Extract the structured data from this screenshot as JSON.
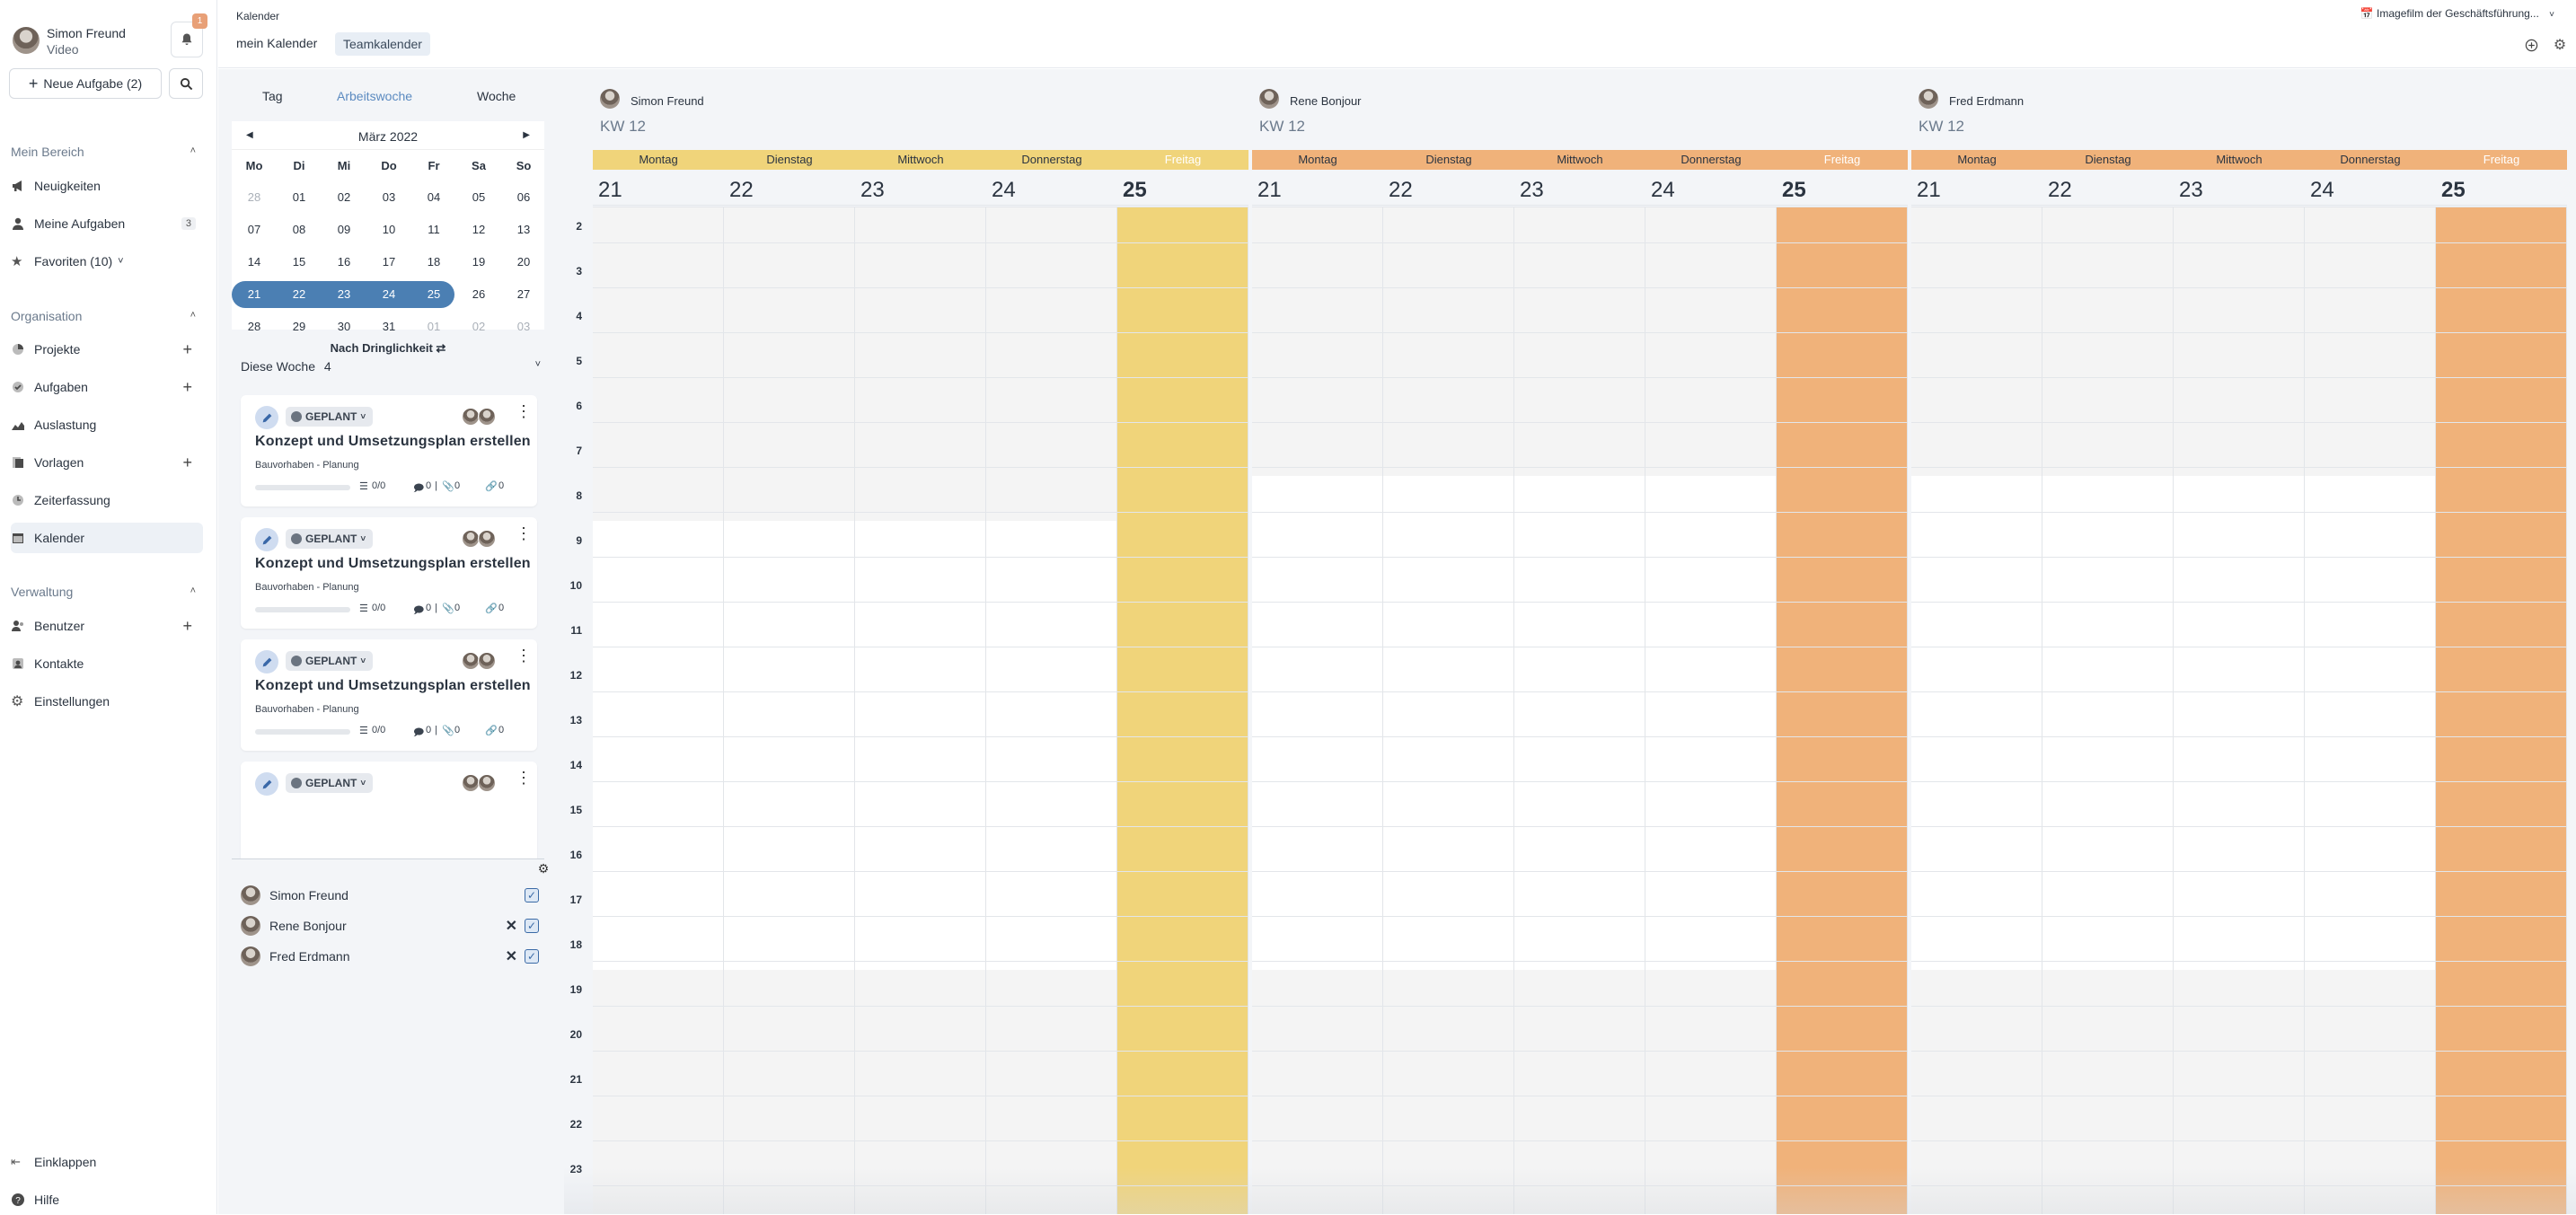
{
  "user": {
    "name": "Simon Freund",
    "role": "Video",
    "notification_count": "1"
  },
  "sidebar": {
    "new_task_label": "Neue Aufgabe (2)",
    "sections": {
      "mein_bereich": "Mein Bereich",
      "organisation": "Organisation",
      "verwaltung": "Verwaltung"
    },
    "items": {
      "neuigkeiten": "Neuigkeiten",
      "meine_aufgaben": "Meine Aufgaben",
      "meine_aufgaben_count": "3",
      "favoriten": "Favoriten (10)",
      "projekte": "Projekte",
      "aufgaben": "Aufgaben",
      "auslastung": "Auslastung",
      "vorlagen": "Vorlagen",
      "zeiterfassung": "Zeiterfassung",
      "kalender": "Kalender",
      "benutzer": "Benutzer",
      "kontakte": "Kontakte",
      "einstellungen": "Einstellungen",
      "einklappen": "Einklappen",
      "hilfe": "Hilfe"
    }
  },
  "topbar": {
    "breadcrumb": "Kalender",
    "tab_mein": "mein Kalender",
    "tab_team": "Teamkalender",
    "project_select": "📅 Imagefilm der Geschäftsführung..."
  },
  "view_tabs": {
    "tag": "Tag",
    "arbeitswoche": "Arbeitswoche",
    "woche": "Woche"
  },
  "mini_calendar": {
    "month": "März 2022",
    "weekdays": [
      "Mo",
      "Di",
      "Mi",
      "Do",
      "Fr",
      "Sa",
      "So"
    ],
    "weeks": [
      [
        "28",
        "01",
        "02",
        "03",
        "04",
        "05",
        "06"
      ],
      [
        "07",
        "08",
        "09",
        "10",
        "11",
        "12",
        "13"
      ],
      [
        "14",
        "15",
        "16",
        "17",
        "18",
        "19",
        "20"
      ],
      [
        "21",
        "22",
        "23",
        "24",
        "25",
        "26",
        "27"
      ],
      [
        "28",
        "29",
        "30",
        "31",
        "01",
        "02",
        "03"
      ]
    ]
  },
  "tasks": {
    "sort_label": "Nach Dringlichkeit ⇄",
    "filter_label": "Diese Woche",
    "filter_count": "4",
    "items": [
      {
        "status": "GEPLANT",
        "title": "Konzept und Umsetzungsplan erstellen",
        "project": "Bauvorhaben - Planung",
        "checklist": "0/0",
        "comments": "0",
        "attachments": "0",
        "links": "0"
      },
      {
        "status": "GEPLANT",
        "title": "Konzept und Umsetzungsplan erstellen",
        "project": "Bauvorhaben - Planung",
        "checklist": "0/0",
        "comments": "0",
        "attachments": "0",
        "links": "0"
      },
      {
        "status": "GEPLANT",
        "title": "Konzept und Umsetzungsplan erstellen",
        "project": "Bauvorhaben - Planung",
        "checklist": "0/0",
        "comments": "0",
        "attachments": "0",
        "links": "0"
      },
      {
        "status": "GEPLANT",
        "title": "",
        "project": "",
        "checklist": "",
        "comments": "",
        "attachments": "",
        "links": ""
      }
    ]
  },
  "members": [
    {
      "name": "Simon Freund",
      "removable": false,
      "checked": true
    },
    {
      "name": "Rene Bonjour",
      "removable": true,
      "checked": true
    },
    {
      "name": "Fred Erdmann",
      "removable": true,
      "checked": true
    }
  ],
  "calendar": {
    "hours": [
      "2",
      "3",
      "4",
      "5",
      "6",
      "7",
      "8",
      "9",
      "10",
      "11",
      "12",
      "13",
      "14",
      "15",
      "16",
      "17",
      "18",
      "19",
      "20",
      "21",
      "22",
      "23"
    ],
    "days": [
      "Montag",
      "Dienstag",
      "Mittwoch",
      "Donnerstag",
      "Freitag"
    ],
    "day_numbers": [
      "21",
      "22",
      "23",
      "24",
      "25"
    ],
    "today_index": 4,
    "persons": [
      {
        "name": "Simon Freund",
        "week": "KW 12",
        "color": "#f0d47a",
        "today_color": "#f0d47a"
      },
      {
        "name": "Rene Bonjour",
        "week": "KW 12",
        "color": "#f0b27a",
        "today_color": "#f0b27a"
      },
      {
        "name": "Fred Erdmann",
        "week": "KW 12",
        "color": "#f0b27a",
        "today_color": "#f0b27a"
      }
    ]
  },
  "colors": {
    "accent": "#4b7fb3",
    "badge": "#e8a077"
  }
}
